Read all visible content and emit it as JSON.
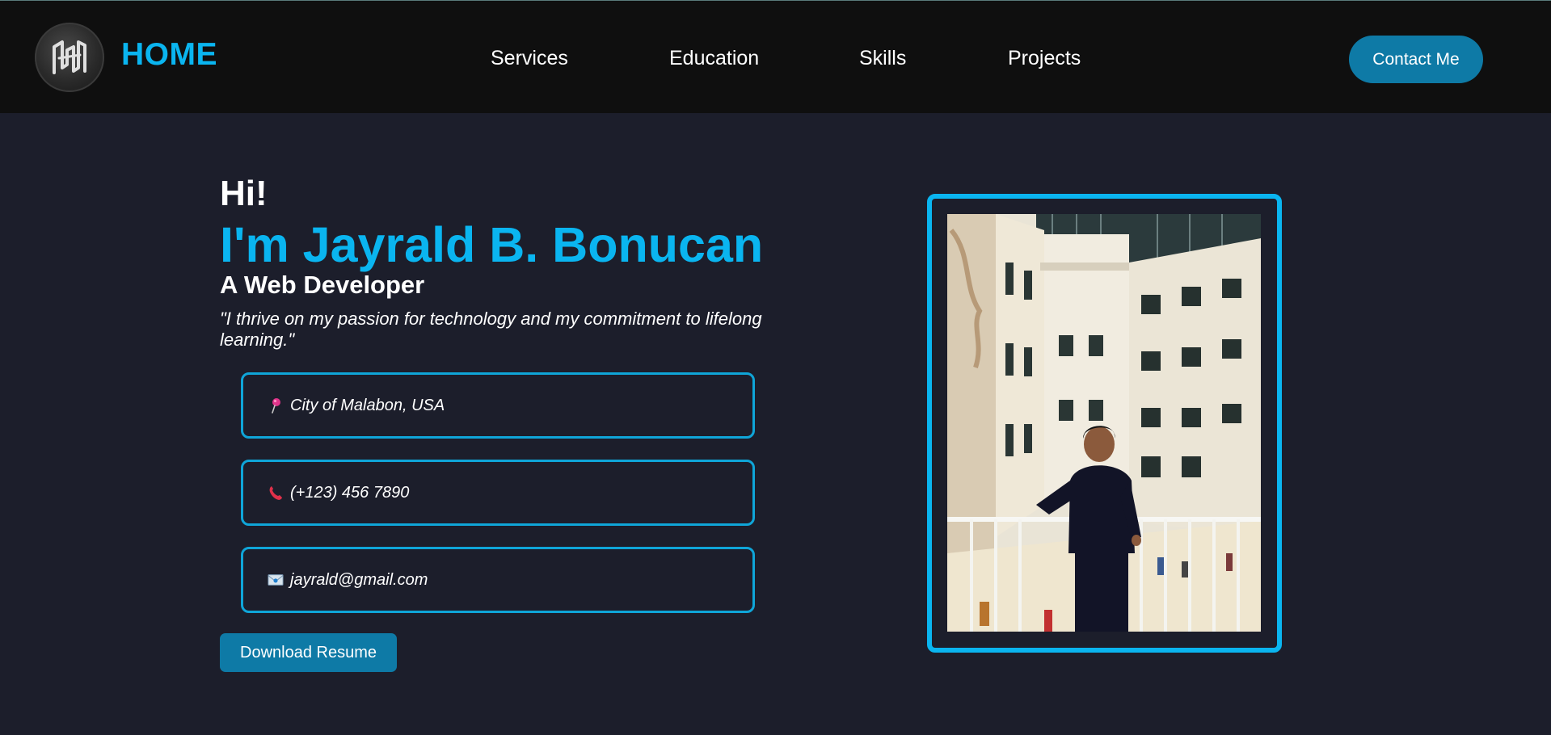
{
  "navbar": {
    "brand": "HOME",
    "links": [
      "Services",
      "Education",
      "Skills",
      "Projects"
    ],
    "contact_label": "Contact Me",
    "logo_icon": "brand-logo-icon"
  },
  "hero": {
    "greeting": "Hi!",
    "name": "I'm Jayrald B. Bonucan",
    "role": "A Web Developer",
    "quote": "\"I thrive on my passion for technology and my commitment to lifelong learning.\"",
    "location": "City of Malabon, USA",
    "phone": "(+123) 456 7890",
    "email": "jayrald@gmail.com",
    "download_label": "Download Resume",
    "icons": {
      "location": "pushpin-icon",
      "phone": "telephone-icon",
      "email": "envelope-icon"
    }
  },
  "colors": {
    "accent": "#0ab5f0",
    "button": "#0e7aa6",
    "background": "#1c1e2b",
    "navbar": "#0f0f0f"
  }
}
